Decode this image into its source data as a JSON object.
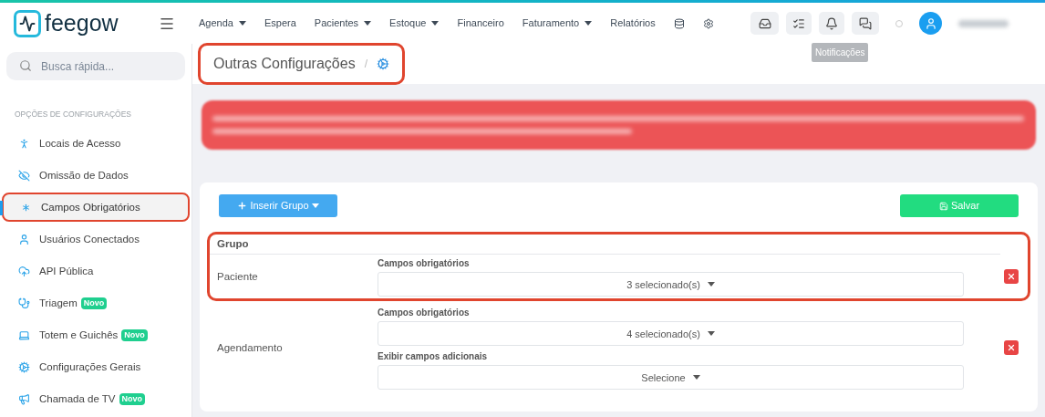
{
  "brand": {
    "name": "feegow"
  },
  "search": {
    "placeholder": "Busca rápida..."
  },
  "nav": [
    {
      "label": "Agenda",
      "dropdown": true
    },
    {
      "label": "Espera",
      "dropdown": false
    },
    {
      "label": "Pacientes",
      "dropdown": true
    },
    {
      "label": "Estoque",
      "dropdown": true
    },
    {
      "label": "Financeiro",
      "dropdown": false
    },
    {
      "label": "Faturamento",
      "dropdown": true
    },
    {
      "label": "Relatórios",
      "dropdown": false
    }
  ],
  "tooltip": "Notificações",
  "breadcrumb": {
    "title": "Outras Configurações",
    "separator": "/",
    "highlighted": true
  },
  "sidebar": {
    "heading": "OPÇÕES DE CONFIGURAÇÕES",
    "items": [
      {
        "label": "Locais de Acesso",
        "selected": false
      },
      {
        "label": "Omissão de Dados",
        "selected": false
      },
      {
        "label": "Campos Obrigatórios",
        "selected": true
      },
      {
        "label": "Usuários Conectados",
        "selected": false
      },
      {
        "label": "API Pública",
        "selected": false
      },
      {
        "label": "Triagem",
        "selected": false,
        "badge": "Novo"
      },
      {
        "label": "Totem e Guichês",
        "selected": false,
        "badge": "Novo"
      },
      {
        "label": "Configurações Gerais",
        "selected": false
      },
      {
        "label": "Chamada de TV",
        "selected": false,
        "badge": "Novo"
      }
    ]
  },
  "toolbar": {
    "insert": "Inserir Grupo",
    "save": "Salvar"
  },
  "table": {
    "header": "Grupo",
    "rows": [
      {
        "name": "Paciente",
        "highlighted": true,
        "fields": [
          {
            "label": "Campos obrigatórios",
            "value": "3 selecionado(s)"
          }
        ]
      },
      {
        "name": "Agendamento",
        "highlighted": false,
        "fields": [
          {
            "label": "Campos obrigatórios",
            "value": "4 selecionado(s)"
          },
          {
            "label": "Exibir campos adicionais",
            "value": "Selecione"
          }
        ]
      }
    ]
  }
}
